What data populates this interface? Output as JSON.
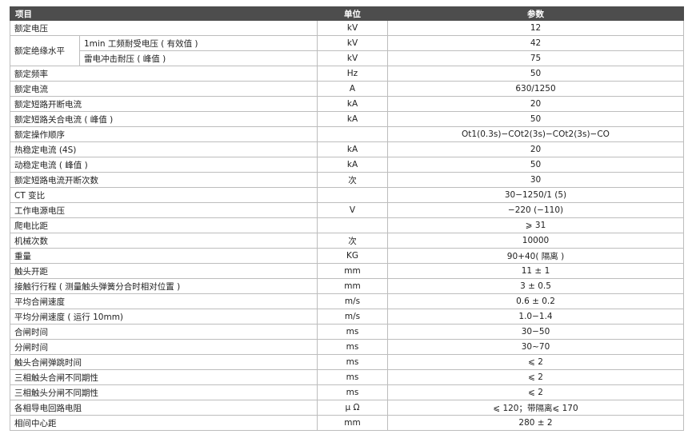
{
  "headers": {
    "item": "项目",
    "unit": "单位",
    "param": "参数"
  },
  "group": {
    "label": "额定绝缘水平",
    "sub": [
      {
        "label": "1min 工频耐受电压 ( 有效值 )",
        "unit": "kV",
        "value": "42"
      },
      {
        "label": "雷电冲击耐压 ( 峰值 )",
        "unit": "kV",
        "value": "75"
      }
    ]
  },
  "rows_before": [
    {
      "label": "额定电压",
      "unit": "kV",
      "value": "12"
    }
  ],
  "rows_after": [
    {
      "label": "额定频率",
      "unit": "Hz",
      "value": "50"
    },
    {
      "label": "额定电流",
      "unit": "A",
      "value": "630/1250"
    },
    {
      "label": "额定短路开断电流",
      "unit": "kA",
      "value": "20"
    },
    {
      "label": "额定短路关合电流 ( 峰值 )",
      "unit": "kA",
      "value": "50"
    },
    {
      "label": "额定操作顺序",
      "unit": "",
      "value": "Ot1(0.3s)−COt2(3s)−COt2(3s)−CO"
    },
    {
      "label": "热稳定电流 (4S)",
      "unit": "kA",
      "value": "20"
    },
    {
      "label": "动稳定电流 ( 峰值 )",
      "unit": "kA",
      "value": "50"
    },
    {
      "label": "额定短路电流开断次数",
      "unit": "次",
      "value": "30"
    },
    {
      "label": "CT 变比",
      "unit": "",
      "value": "30−1250/1 (5)"
    },
    {
      "label": "工作电源电压",
      "unit": "V",
      "value": "−220 (−110)"
    },
    {
      "label": "爬电比距",
      "unit": "",
      "value": "⩾ 31"
    },
    {
      "label": "机械次数",
      "unit": "次",
      "value": "10000"
    },
    {
      "label": "重量",
      "unit": "KG",
      "value": "90+40( 隔离 )"
    },
    {
      "label": "触头开距",
      "unit": "mm",
      "value": "11 ± 1"
    },
    {
      "label": "接触行行程 ( 测量触头弹簧分合时相对位置 )",
      "unit": "mm",
      "value": "3 ± 0.5"
    },
    {
      "label": "平均合闸速度",
      "unit": "m/s",
      "value": "0.6 ± 0.2"
    },
    {
      "label": "平均分闸速度 ( 运行 10mm)",
      "unit": "m/s",
      "value": "1.0−1.4"
    },
    {
      "label": "合闸时间",
      "unit": "ms",
      "value": "30−50"
    },
    {
      "label": "分闸时间",
      "unit": "ms",
      "value": "30~70"
    },
    {
      "label": "触头合闸弹跳时间",
      "unit": "ms",
      "value": "⩽ 2"
    },
    {
      "label": "三相触头合闸不同期性",
      "unit": "ms",
      "value": "⩽ 2"
    },
    {
      "label": "三相触头分闸不同期性",
      "unit": "ms",
      "value": "⩽ 2"
    },
    {
      "label": "各相导电回路电阻",
      "unit": "μ Ω",
      "value": "⩽ 120；带隔离⩽ 170"
    },
    {
      "label": "相间中心距",
      "unit": "mm",
      "value": "280 ± 2"
    }
  ]
}
